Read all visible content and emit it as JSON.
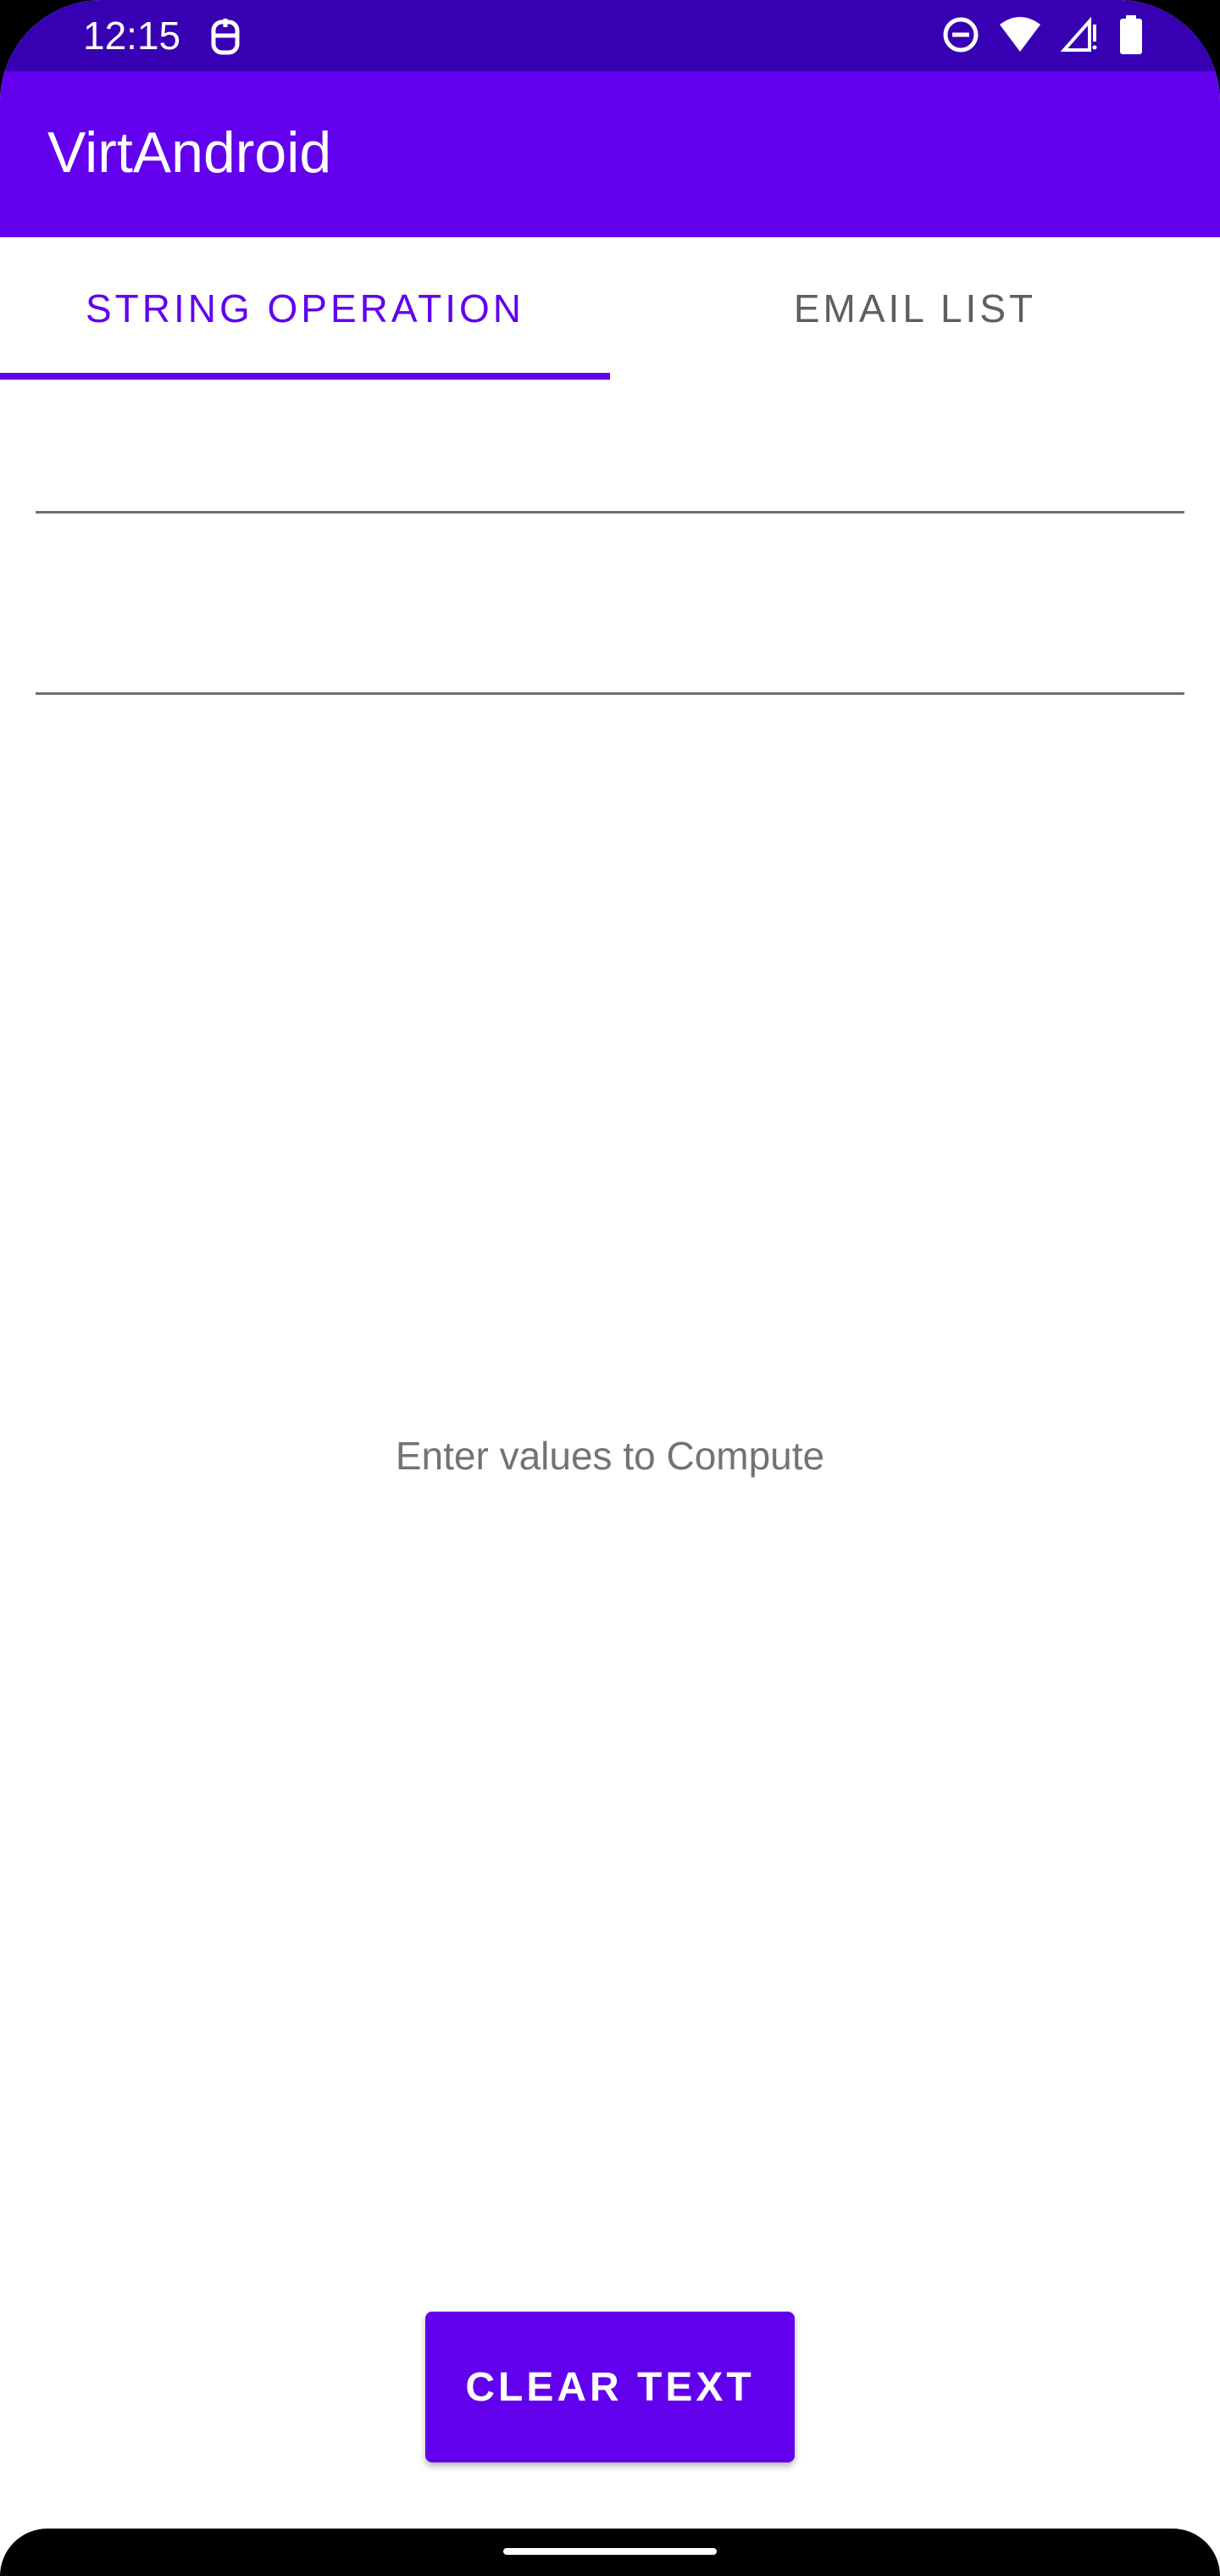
{
  "status_bar": {
    "time": "12:15",
    "left_icon": "sync-icon",
    "right_icons": [
      "do-not-disturb-icon",
      "wifi-icon",
      "cell-signal-icon",
      "battery-icon"
    ]
  },
  "app_bar": {
    "title": "VirtAndroid"
  },
  "tabs": [
    {
      "label": "STRING OPERATION",
      "active": true
    },
    {
      "label": "EMAIL LIST",
      "active": false
    }
  ],
  "inputs": {
    "first": {
      "value": "",
      "placeholder": ""
    },
    "second": {
      "value": "",
      "placeholder": ""
    }
  },
  "result": {
    "text": "Enter values to Compute"
  },
  "actions": {
    "clear_label": "CLEAR TEXT"
  },
  "colors": {
    "status_bar": "#3700b3",
    "primary": "#6200ee",
    "inactive_tab": "#5f5f5f",
    "hint_text": "#737373"
  }
}
